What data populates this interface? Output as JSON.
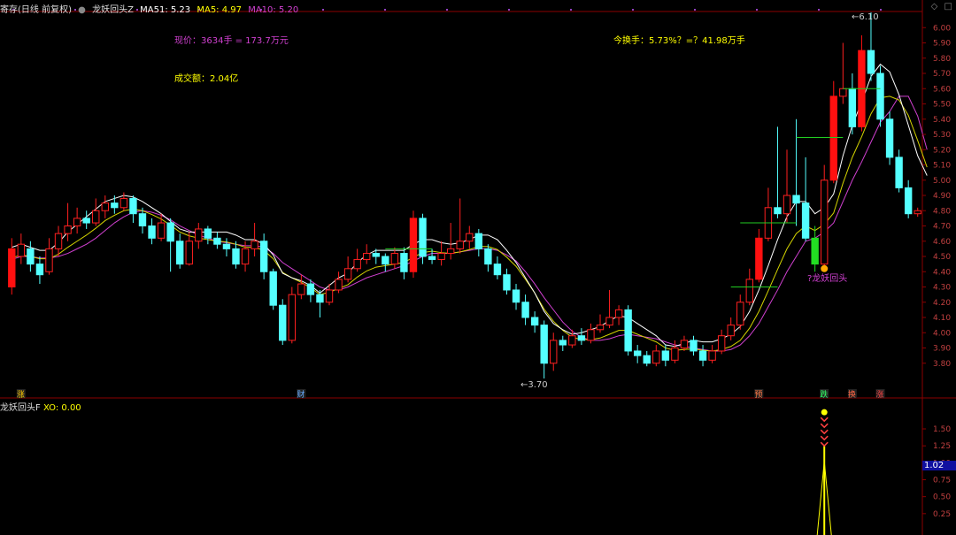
{
  "header": {
    "name": "寄存(日线 前复权)",
    "indicator": "龙妖回头Z",
    "ma51": "MA51: 5.23",
    "ma5": "MA5: 4.97",
    "ma10": "MA10: 5.20"
  },
  "annotations": {
    "price_line": "现价：3634手 = 173.7万元",
    "turnover": "今换手：5.73%？=？41.98万手",
    "volume": "成交额：2.04亿",
    "pattern_label": "?龙妖回头",
    "low_label": "3.70",
    "high_label": "6.10"
  },
  "event_markers": [
    {
      "label": "涨",
      "color": "#ffcc00"
    },
    {
      "label": "财",
      "color": "#66aaff"
    },
    {
      "label": "预",
      "color": "#ff7744"
    },
    {
      "label": "跌",
      "color": "#33ff66"
    },
    {
      "label": "换",
      "color": "#ff6644"
    },
    {
      "label": "涨",
      "color": "#ff4444"
    }
  ],
  "sub_panel": {
    "title": "龙妖回头F",
    "value": "XO: 0.00",
    "current_tag": "1.02"
  },
  "colors": {
    "up": "#ff2020",
    "down": "#54ffff",
    "ma5": "#ffffff",
    "ma10": "#d4d400",
    "ma51": "#d040d0",
    "strong_up": "#ff1010",
    "strong_down": "#22dd22"
  },
  "chart_data": {
    "type": "candlestick",
    "y_axis_main": {
      "ticks": [
        3.8,
        3.9,
        4.0,
        4.1,
        4.2,
        4.3,
        4.4,
        4.5,
        4.6,
        4.7,
        4.8,
        4.9,
        5.0,
        5.1,
        5.2,
        5.3,
        5.4,
        5.5,
        5.6,
        5.7,
        5.8,
        5.9,
        6.0
      ],
      "range": [
        3.7,
        6.1
      ]
    },
    "y_axis_sub": {
      "ticks": [
        0.25,
        0.5,
        0.75,
        1.0,
        1.25,
        1.5
      ],
      "range": [
        0,
        1.8
      ]
    },
    "candles": [
      [
        4.3,
        4.55,
        4.62,
        4.25
      ],
      [
        4.5,
        4.58,
        4.65,
        4.45
      ],
      [
        4.55,
        4.45,
        4.6,
        4.4
      ],
      [
        4.45,
        4.38,
        4.5,
        4.32
      ],
      [
        4.4,
        4.55,
        4.62,
        4.38
      ],
      [
        4.55,
        4.65,
        4.7,
        4.5
      ],
      [
        4.65,
        4.7,
        4.85,
        4.6
      ],
      [
        4.7,
        4.75,
        4.82,
        4.65
      ],
      [
        4.75,
        4.72,
        4.8,
        4.68
      ],
      [
        4.72,
        4.8,
        4.88,
        4.7
      ],
      [
        4.8,
        4.85,
        4.9,
        4.75
      ],
      [
        4.85,
        4.82,
        4.9,
        4.78
      ],
      [
        4.82,
        4.88,
        4.92,
        4.8
      ],
      [
        4.88,
        4.78,
        4.9,
        4.72
      ],
      [
        4.78,
        4.7,
        4.82,
        4.65
      ],
      [
        4.7,
        4.62,
        4.75,
        4.58
      ],
      [
        4.62,
        4.72,
        4.78,
        4.6
      ],
      [
        4.72,
        4.6,
        4.75,
        4.4
      ],
      [
        4.6,
        4.45,
        4.65,
        4.42
      ],
      [
        4.45,
        4.6,
        4.66,
        4.44
      ],
      [
        4.6,
        4.68,
        4.72,
        4.55
      ],
      [
        4.68,
        4.62,
        4.7,
        4.58
      ],
      [
        4.62,
        4.58,
        4.66,
        4.55
      ],
      [
        4.58,
        4.55,
        4.62,
        4.5
      ],
      [
        4.55,
        4.45,
        4.6,
        4.42
      ],
      [
        4.45,
        4.55,
        4.6,
        4.4
      ],
      [
        4.55,
        4.6,
        4.72,
        4.5
      ],
      [
        4.6,
        4.4,
        4.65,
        4.35
      ],
      [
        4.4,
        4.18,
        4.42,
        4.15
      ],
      [
        4.18,
        3.95,
        4.22,
        3.92
      ],
      [
        3.95,
        4.25,
        4.3,
        3.93
      ],
      [
        4.25,
        4.32,
        4.38,
        4.22
      ],
      [
        4.32,
        4.25,
        4.35,
        4.2
      ],
      [
        4.25,
        4.2,
        4.28,
        4.1
      ],
      [
        4.2,
        4.28,
        4.32,
        4.18
      ],
      [
        4.28,
        4.35,
        4.4,
        4.26
      ],
      [
        4.35,
        4.42,
        4.5,
        4.33
      ],
      [
        4.42,
        4.48,
        4.55,
        4.4
      ],
      [
        4.48,
        4.52,
        4.58,
        4.45
      ],
      [
        4.52,
        4.5,
        4.55,
        4.45
      ],
      [
        4.5,
        4.45,
        4.52,
        4.4
      ],
      [
        4.45,
        4.52,
        4.56,
        4.42
      ],
      [
        4.52,
        4.4,
        4.56,
        4.35
      ],
      [
        4.4,
        4.75,
        4.8,
        4.36
      ],
      [
        4.75,
        4.5,
        4.78,
        4.45
      ],
      [
        4.5,
        4.48,
        4.55,
        4.45
      ],
      [
        4.48,
        4.52,
        4.6,
        4.44
      ],
      [
        4.52,
        4.55,
        4.72,
        4.48
      ],
      [
        4.55,
        4.6,
        4.88,
        4.52
      ],
      [
        4.6,
        4.65,
        4.7,
        4.55
      ],
      [
        4.65,
        4.55,
        4.68,
        4.5
      ],
      [
        4.55,
        4.45,
        4.58,
        4.4
      ],
      [
        4.45,
        4.38,
        4.5,
        4.35
      ],
      [
        4.38,
        4.28,
        4.42,
        4.25
      ],
      [
        4.28,
        4.2,
        4.32,
        4.15
      ],
      [
        4.2,
        4.1,
        4.25,
        4.05
      ],
      [
        4.1,
        4.05,
        4.14,
        4.0
      ],
      [
        4.05,
        3.8,
        4.08,
        3.7
      ],
      [
        3.8,
        3.95,
        4.0,
        3.75
      ],
      [
        3.95,
        3.92,
        3.98,
        3.88
      ],
      [
        3.92,
        3.98,
        4.02,
        3.9
      ],
      [
        3.98,
        3.95,
        4.03,
        3.92
      ],
      [
        3.95,
        4.02,
        4.06,
        3.93
      ],
      [
        4.02,
        4.05,
        4.12,
        4.0
      ],
      [
        4.05,
        4.1,
        4.28,
        4.03
      ],
      [
        4.1,
        4.15,
        4.18,
        4.05
      ],
      [
        4.15,
        3.88,
        4.18,
        3.85
      ],
      [
        3.88,
        3.85,
        3.92,
        3.8
      ],
      [
        3.85,
        3.8,
        3.88,
        3.78
      ],
      [
        3.8,
        3.88,
        3.92,
        3.78
      ],
      [
        3.88,
        3.82,
        3.92,
        3.78
      ],
      [
        3.82,
        3.9,
        3.95,
        3.8
      ],
      [
        3.9,
        3.95,
        3.98,
        3.88
      ],
      [
        3.95,
        3.88,
        3.98,
        3.85
      ],
      [
        3.88,
        3.82,
        3.92,
        3.78
      ],
      [
        3.82,
        3.88,
        3.92,
        3.8
      ],
      [
        3.88,
        3.98,
        4.02,
        3.86
      ],
      [
        3.98,
        4.05,
        4.1,
        3.95
      ],
      [
        4.05,
        4.2,
        4.25,
        4.02
      ],
      [
        4.2,
        4.35,
        4.42,
        4.18
      ],
      [
        4.35,
        4.62,
        4.68,
        4.33
      ],
      [
        4.62,
        4.82,
        4.95,
        4.6
      ],
      [
        4.82,
        4.78,
        5.35,
        4.75
      ],
      [
        4.78,
        4.9,
        5.2,
        4.72
      ],
      [
        4.9,
        4.85,
        5.4,
        4.7
      ],
      [
        4.85,
        4.62,
        5.15,
        4.6
      ],
      [
        4.62,
        4.45,
        4.7,
        4.4
      ],
      [
        4.45,
        5.0,
        5.1,
        4.42
      ],
      [
        5.0,
        5.55,
        5.65,
        4.98
      ],
      [
        5.55,
        5.6,
        5.9,
        5.5
      ],
      [
        5.6,
        5.35,
        5.7,
        5.3
      ],
      [
        5.35,
        5.85,
        5.95,
        5.32
      ],
      [
        5.85,
        5.7,
        6.1,
        5.65
      ],
      [
        5.7,
        5.4,
        5.75,
        5.35
      ],
      [
        5.4,
        5.15,
        5.45,
        5.1
      ],
      [
        5.15,
        4.95,
        5.2,
        4.92
      ],
      [
        4.95,
        4.78,
        5.0,
        4.75
      ],
      [
        4.78,
        4.8,
        4.82,
        4.76
      ]
    ],
    "ma5": [
      4.5,
      4.52,
      4.5,
      4.48,
      4.48,
      4.53,
      4.6,
      4.65,
      4.7,
      4.75,
      4.8,
      4.82,
      4.84,
      4.83,
      4.8,
      4.76,
      4.72,
      4.67,
      4.62,
      4.6,
      4.6,
      4.6,
      4.6,
      4.6,
      4.58,
      4.55,
      4.55,
      4.52,
      4.45,
      4.33,
      4.3,
      4.28,
      4.25,
      4.2,
      4.25,
      4.3,
      4.33,
      4.4,
      4.45,
      4.48,
      4.48,
      4.48,
      4.48,
      4.52,
      4.55,
      4.55,
      4.53,
      4.52,
      4.53,
      4.55,
      4.58,
      4.58,
      4.55,
      4.48,
      4.4,
      4.3,
      4.2,
      4.08,
      4.0,
      3.96,
      3.93,
      3.94,
      3.96,
      3.98,
      4.02,
      4.05,
      4.04,
      4.0,
      3.96,
      3.92,
      3.86,
      3.85,
      3.87,
      3.89,
      3.88,
      3.88,
      3.9,
      3.93,
      3.98,
      4.08,
      4.22,
      4.38,
      4.55,
      4.7,
      4.8,
      4.8,
      4.72,
      4.76,
      4.85,
      5.1,
      5.3,
      5.45,
      5.62,
      5.7,
      5.65,
      5.5,
      5.3,
      5.1,
      4.97
    ],
    "ma10": [
      4.48,
      4.5,
      4.5,
      4.49,
      4.49,
      4.5,
      4.52,
      4.55,
      4.58,
      4.62,
      4.67,
      4.72,
      4.76,
      4.79,
      4.8,
      4.79,
      4.77,
      4.74,
      4.7,
      4.67,
      4.64,
      4.62,
      4.6,
      4.59,
      4.58,
      4.57,
      4.57,
      4.56,
      4.52,
      4.46,
      4.42,
      4.38,
      4.34,
      4.3,
      4.28,
      4.28,
      4.3,
      4.33,
      4.36,
      4.38,
      4.4,
      4.42,
      4.44,
      4.47,
      4.5,
      4.52,
      4.52,
      4.52,
      4.53,
      4.54,
      4.55,
      4.55,
      4.54,
      4.51,
      4.47,
      4.4,
      4.32,
      4.23,
      4.15,
      4.07,
      4.01,
      3.97,
      3.95,
      3.95,
      3.96,
      3.98,
      3.99,
      3.98,
      3.97,
      3.96,
      3.94,
      3.92,
      3.91,
      3.9,
      3.89,
      3.88,
      3.88,
      3.89,
      3.92,
      3.98,
      4.06,
      4.17,
      4.28,
      4.4,
      4.5,
      4.6,
      4.62,
      4.66,
      4.72,
      4.86,
      5.0,
      5.12,
      5.25,
      5.38,
      5.45,
      5.55,
      5.55,
      5.42,
      5.2
    ]
  }
}
